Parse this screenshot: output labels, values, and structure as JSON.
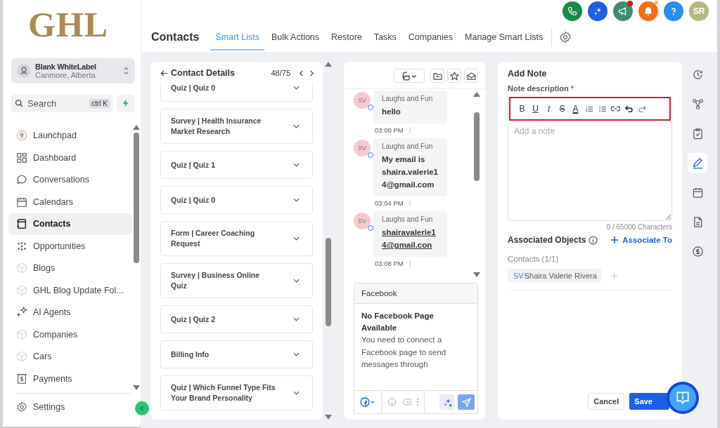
{
  "logo": "GHL",
  "account": {
    "name": "Blank WhiteLabel",
    "location": "Canmore, Alberta"
  },
  "search": {
    "placeholder": "Search",
    "shortcut": "ctrl K"
  },
  "nav": [
    {
      "label": "Launchpad",
      "kind": "launchpad",
      "selected": false
    },
    {
      "label": "Dashboard",
      "kind": "grid",
      "selected": false
    },
    {
      "label": "Conversations",
      "kind": "chat",
      "selected": false
    },
    {
      "label": "Calendars",
      "kind": "calendar",
      "selected": false
    },
    {
      "label": "Contacts",
      "kind": "book",
      "selected": true
    },
    {
      "label": "Opportunities",
      "kind": "dots",
      "selected": false
    },
    {
      "label": "Blogs",
      "kind": "cube",
      "selected": false
    },
    {
      "label": "GHL Blog Update Fol...",
      "kind": "cube",
      "selected": false
    },
    {
      "label": "AI Agents",
      "kind": "sparkle",
      "selected": false
    },
    {
      "label": "Companies",
      "kind": "cube",
      "selected": false
    },
    {
      "label": "Cars",
      "kind": "cube",
      "selected": false
    },
    {
      "label": "Payments",
      "kind": "dollar",
      "selected": false
    }
  ],
  "settings": {
    "label": "Settings"
  },
  "header": {
    "title": "Contacts",
    "tabs": [
      {
        "label": "Smart Lists",
        "selected": true
      },
      {
        "label": "Bulk Actions",
        "selected": false
      },
      {
        "label": "Restore",
        "selected": false
      },
      {
        "label": "Tasks",
        "selected": false
      },
      {
        "label": "Companies",
        "selected": false
      },
      {
        "label": "Manage Smart Lists",
        "selected": false
      }
    ]
  },
  "top_actions": [
    {
      "kind": "phone",
      "color": "#188a4a",
      "notified": false
    },
    {
      "kind": "sparkle",
      "color": "#1f5fe0",
      "notified": false
    },
    {
      "kind": "megaphone",
      "color": "#3f8c72",
      "notified": true
    },
    {
      "kind": "bell",
      "color": "#f07014",
      "notified": true
    },
    {
      "kind": "help",
      "color": "#2a8cf0",
      "notified": false
    },
    {
      "kind": "avatar",
      "color": "#b3b77a",
      "notified": false,
      "initials": "SR"
    }
  ],
  "contact_details": {
    "title": "Contact Details",
    "position": "48/75",
    "sections": [
      "Quiz | Quiz 0",
      "Survey | Health Insurance Market Research",
      "Quiz | Quiz 1",
      "Quiz | Quiz 0",
      "Form | Career Coaching Request",
      "Survey | Business Online Quiz",
      "Quiz | Quiz 2",
      "Billing Info",
      "Quiz | Which Funnel Type Fits Your Brand Personality"
    ]
  },
  "conversation": {
    "messages": [
      {
        "initials": "SV",
        "sender": "Laughs and Fun",
        "text": "hello",
        "time": "03:00 PM",
        "link": false
      },
      {
        "initials": "SV",
        "sender": "Laughs and Fun",
        "text": "My email is shaira.valerie14@gmail.com",
        "time": "03:04 PM",
        "link": false
      },
      {
        "initials": "SV",
        "sender": "Laughs and Fun",
        "text": "shairavalerie14@gmail.con",
        "time": "03:08 PM",
        "link": true
      }
    ],
    "channel": {
      "title": "Facebook",
      "heading": "No Facebook Page Available",
      "body": "You need to connect a Facebook page to send messages through"
    }
  },
  "note": {
    "title": "Add Note",
    "field_label": "Note description",
    "required_mark": "*",
    "tools": [
      {
        "kind": "bold",
        "label": "B"
      },
      {
        "kind": "underline",
        "label": "U"
      },
      {
        "kind": "italic",
        "label": "I"
      },
      {
        "kind": "strike",
        "label": "S"
      },
      {
        "kind": "color",
        "label": "A"
      },
      {
        "kind": "ordered-list"
      },
      {
        "kind": "bullet-list"
      },
      {
        "kind": "link"
      },
      {
        "kind": "undo"
      },
      {
        "kind": "redo"
      }
    ],
    "placeholder": "Add a note",
    "counter": "0 / 65000 Characters",
    "associated_title": "Associated Objects",
    "associate_action": "Associate To",
    "contacts_label": "Contacts (1/1)",
    "contact_chip": {
      "initials": "SV",
      "name": "Shaira Valerie Rivera"
    },
    "cancel": "Cancel",
    "save": "Save"
  },
  "rail": [
    {
      "kind": "clock",
      "selected": false
    },
    {
      "kind": "workflow",
      "selected": false
    },
    {
      "kind": "task",
      "selected": false
    },
    {
      "kind": "pen",
      "selected": true
    },
    {
      "kind": "calendar",
      "selected": false
    },
    {
      "kind": "document",
      "selected": false
    },
    {
      "kind": "dollar",
      "selected": false
    }
  ]
}
